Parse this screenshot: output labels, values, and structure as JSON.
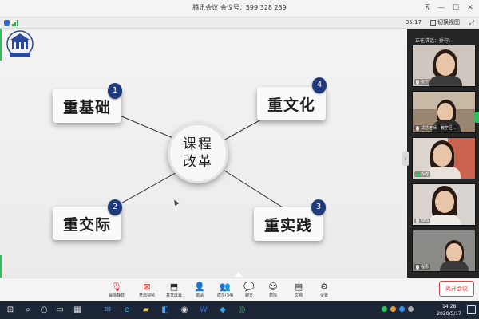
{
  "window": {
    "title": "腾讯会议  会议号：599 328 239",
    "timer": "35:17",
    "switch_view_label": "切换视图"
  },
  "slide": {
    "center_line1": "课程",
    "center_line2": "改革",
    "items": [
      {
        "label": "重基础",
        "number": "1"
      },
      {
        "label": "重文化",
        "number": "4"
      },
      {
        "label": "重交际",
        "number": "2"
      },
      {
        "label": "重实践",
        "number": "3"
      }
    ]
  },
  "sidebar": {
    "speaking_label": "正在讲话：乔柠;",
    "participants": [
      {
        "name": "张宁"
      },
      {
        "name": "郑慧老师—教学区..."
      },
      {
        "name": "乔柠"
      },
      {
        "name": "Nita"
      },
      {
        "name": "程思"
      }
    ]
  },
  "toolbar": {
    "items": [
      {
        "label": "解除静音",
        "icon": "mic-muted-icon"
      },
      {
        "label": "开启视频",
        "icon": "camera-off-icon"
      },
      {
        "label": "共享屏幕",
        "icon": "share-screen-icon"
      },
      {
        "label": "邀请",
        "icon": "invite-icon"
      },
      {
        "label": "成员(34)",
        "icon": "members-icon"
      },
      {
        "label": "聊天",
        "icon": "chat-icon"
      },
      {
        "label": "表情",
        "icon": "emoji-icon"
      },
      {
        "label": "文档",
        "icon": "document-icon"
      },
      {
        "label": "设置",
        "icon": "settings-icon"
      }
    ],
    "leave_label": "离开会议"
  },
  "taskbar": {
    "time": "14:28",
    "date": "2020/5/17"
  }
}
